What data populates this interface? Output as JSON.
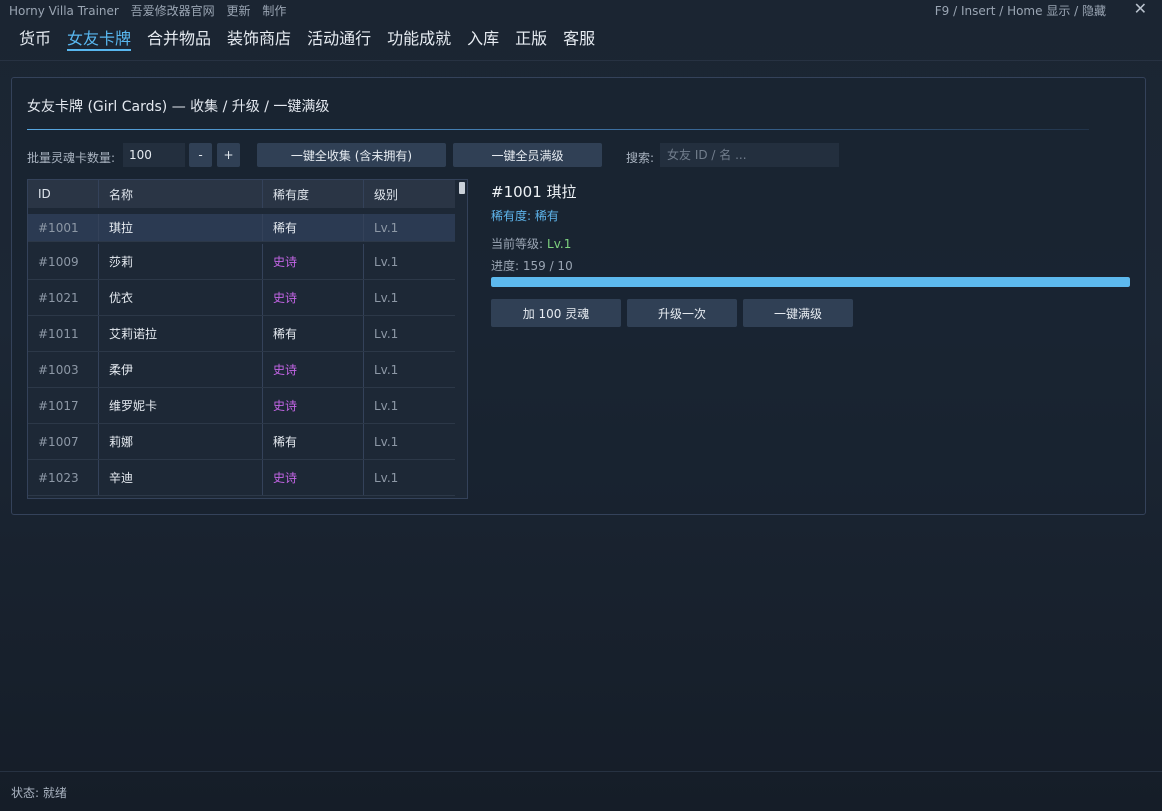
{
  "titlebar": {
    "app_name": "Horny Villa Trainer",
    "links": [
      "吾爱修改器官网",
      "更新",
      "制作"
    ],
    "hotkey_hint": "F9 / Insert / Home  显示 / 隐藏",
    "close_glyph": "✕"
  },
  "nav": {
    "tabs": [
      "货币",
      "女友卡牌",
      "合并物品",
      "装饰商店",
      "活动通行",
      "功能成就",
      "入库",
      "正版",
      "客服"
    ],
    "active": "女友卡牌"
  },
  "panel": {
    "title": "女友卡牌 (Girl Cards) — 收集 / 升级 / 一键满级",
    "batch_label": "批量灵魂卡数量:",
    "batch_value": "100",
    "minus_label": "-",
    "plus_label": "+",
    "collect_all_label": "一键全收集 (含未拥有)",
    "max_all_label": "一键全员满级",
    "search_label": "搜索:",
    "search_placeholder": "女友 ID / 名 ..."
  },
  "table": {
    "headers": [
      "ID",
      "名称",
      "稀有度",
      "级别"
    ],
    "rows": [
      {
        "id": "#1001",
        "name": "琪拉",
        "rarity": "稀有",
        "level": "Lv.1"
      },
      {
        "id": "#1009",
        "name": "莎莉",
        "rarity": "史诗",
        "level": "Lv.1"
      },
      {
        "id": "#1021",
        "name": "优衣",
        "rarity": "史诗",
        "level": "Lv.1"
      },
      {
        "id": "#1011",
        "name": "艾莉诺拉",
        "rarity": "稀有",
        "level": "Lv.1"
      },
      {
        "id": "#1003",
        "name": "柔伊",
        "rarity": "史诗",
        "level": "Lv.1"
      },
      {
        "id": "#1017",
        "name": "维罗妮卡",
        "rarity": "史诗",
        "level": "Lv.1"
      },
      {
        "id": "#1007",
        "name": "莉娜",
        "rarity": "稀有",
        "level": "Lv.1"
      },
      {
        "id": "#1023",
        "name": "辛迪",
        "rarity": "史诗",
        "level": "Lv.1"
      }
    ],
    "selected_index": 0
  },
  "detail": {
    "title": "#1001  琪拉",
    "rarity_text": "稀有度: 稀有",
    "level_label": "当前等级:",
    "level_value": "Lv.1",
    "progress_text": "进度: 159 / 10",
    "progress_fraction": 1.0,
    "add_soul_label": "加 100 灵魂",
    "upgrade_once_label": "升级一次",
    "max_label": "一键满级"
  },
  "status": {
    "text": "状态: 就绪"
  },
  "colors": {
    "accent": "#58b7ef",
    "epic": "#c465e6",
    "level_green": "#7ed37f",
    "button": "#304055"
  }
}
